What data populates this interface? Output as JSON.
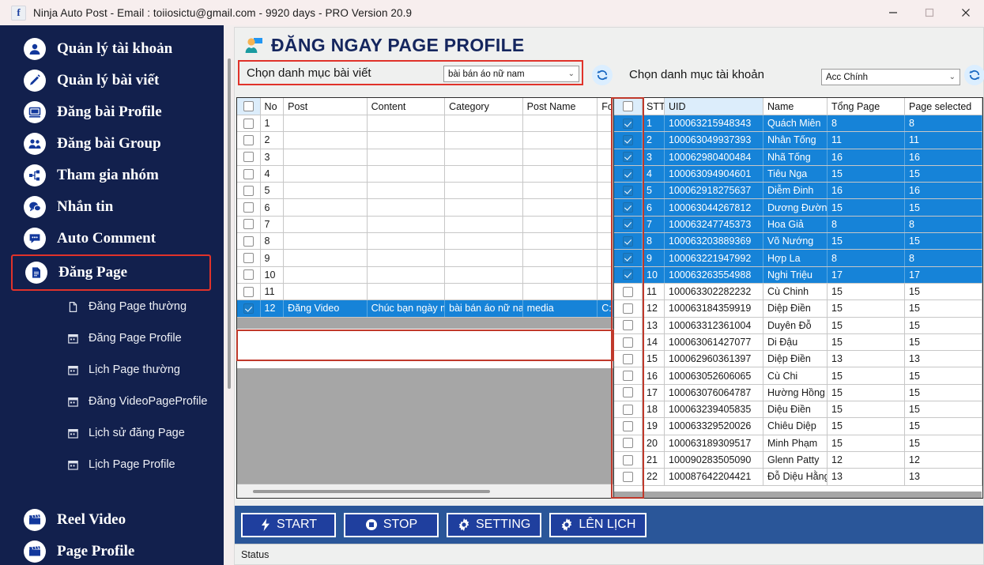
{
  "window": {
    "title": "Ninja Auto Post - Email : toiiosictu@gmail.com - 9920 days -  PRO Version 20.9",
    "app_icon": "facebook-icon",
    "minimize_label": "—",
    "maximize_label": "□",
    "close_label": "✕"
  },
  "sidebar": {
    "items": [
      {
        "label": "Quản lý tài khoản",
        "icon": "user-icon"
      },
      {
        "label": "Quản lý bài viết",
        "icon": "pencil-icon"
      },
      {
        "label": "Đăng bài Profile",
        "icon": "monitor-icon"
      },
      {
        "label": "Đăng bài Group",
        "icon": "users-icon"
      },
      {
        "label": "Tham gia nhóm",
        "icon": "network-icon"
      },
      {
        "label": "Nhắn tin",
        "icon": "chat-icon"
      },
      {
        "label": "Auto Comment",
        "icon": "comment-icon"
      },
      {
        "label": "Đăng Page",
        "icon": "document-icon"
      }
    ],
    "sub_items": [
      {
        "label": "Đăng Page thường",
        "icon": "page-icon"
      },
      {
        "label": "Đăng Page Profile",
        "icon": "calendar-icon"
      },
      {
        "label": "Lịch Page thường",
        "icon": "calendar-icon"
      },
      {
        "label": "Đăng VideoPageProfile",
        "icon": "calendar-icon"
      },
      {
        "label": "Lịch sử đăng Page",
        "icon": "calendar-icon"
      },
      {
        "label": "Lịch Page Profile",
        "icon": "calendar-icon"
      }
    ],
    "bottom_items": [
      {
        "label": "Reel Video",
        "icon": "clapperboard-icon"
      },
      {
        "label": "Page Profile",
        "icon": "clapperboard-icon"
      }
    ],
    "active_item": "Đăng Page",
    "highlight_color": "#e0322a",
    "background": "#12204d"
  },
  "header": {
    "title": "ĐĂNG NGAY PAGE PROFILE",
    "icon": "user-card-icon",
    "title_color": "#15265e"
  },
  "toolbar": {
    "post_category_label": "Chọn danh mục bài viết",
    "post_category_value": "bài bán áo nữ nam",
    "account_category_label": "Chọn danh mục tài khoản",
    "account_category_value": "Acc Chính",
    "refresh_icon": "refresh-icon"
  },
  "post_grid": {
    "columns": [
      "",
      "No",
      "Post",
      "Content",
      "Category",
      "Post Name",
      "Fo"
    ],
    "rows": [
      {
        "checked": false,
        "no": "1",
        "post": "",
        "content": "",
        "category": "",
        "post_name": "",
        "folder": ""
      },
      {
        "checked": false,
        "no": "2",
        "post": "",
        "content": "",
        "category": "",
        "post_name": "",
        "folder": ""
      },
      {
        "checked": false,
        "no": "3",
        "post": "",
        "content": "",
        "category": "",
        "post_name": "",
        "folder": ""
      },
      {
        "checked": false,
        "no": "4",
        "post": "",
        "content": "",
        "category": "",
        "post_name": "",
        "folder": ""
      },
      {
        "checked": false,
        "no": "5",
        "post": "",
        "content": "",
        "category": "",
        "post_name": "",
        "folder": ""
      },
      {
        "checked": false,
        "no": "6",
        "post": "",
        "content": "",
        "category": "",
        "post_name": "",
        "folder": ""
      },
      {
        "checked": false,
        "no": "7",
        "post": "",
        "content": "",
        "category": "",
        "post_name": "",
        "folder": ""
      },
      {
        "checked": false,
        "no": "8",
        "post": "",
        "content": "",
        "category": "",
        "post_name": "",
        "folder": ""
      },
      {
        "checked": false,
        "no": "9",
        "post": "",
        "content": "",
        "category": "",
        "post_name": "",
        "folder": ""
      },
      {
        "checked": false,
        "no": "10",
        "post": "",
        "content": "",
        "category": "",
        "post_name": "",
        "folder": ""
      },
      {
        "checked": false,
        "no": "11",
        "post": "",
        "content": "",
        "category": "",
        "post_name": "",
        "folder": ""
      },
      {
        "checked": true,
        "no": "12",
        "post": "Đăng Video",
        "content": "Chúc bạn ngày m...",
        "category": "bài bán áo nữ nam",
        "post_name": "media",
        "folder": "C:\\"
      }
    ]
  },
  "account_grid": {
    "columns": [
      "",
      "STT",
      "UID",
      "Name",
      "Tổng Page",
      "Page selected"
    ],
    "header_checked": false,
    "rows": [
      {
        "checked": true,
        "stt": "1",
        "uid": "100063215948343",
        "name": "Quách Miên",
        "total_page": "8",
        "page_selected": "8"
      },
      {
        "checked": true,
        "stt": "2",
        "uid": "100063049937393",
        "name": "Nhân Tống",
        "total_page": "11",
        "page_selected": "11"
      },
      {
        "checked": true,
        "stt": "3",
        "uid": "100062980400484",
        "name": "Nhã Tống",
        "total_page": "16",
        "page_selected": "16"
      },
      {
        "checked": true,
        "stt": "4",
        "uid": "100063094904601",
        "name": "Tiêu Nga",
        "total_page": "15",
        "page_selected": "15"
      },
      {
        "checked": true,
        "stt": "5",
        "uid": "100062918275637",
        "name": "Diễm Đinh",
        "total_page": "16",
        "page_selected": "16"
      },
      {
        "checked": true,
        "stt": "6",
        "uid": "100063044267812",
        "name": "Dương Đường",
        "total_page": "15",
        "page_selected": "15"
      },
      {
        "checked": true,
        "stt": "7",
        "uid": "100063247745373",
        "name": "Hoa Giả",
        "total_page": "8",
        "page_selected": "8"
      },
      {
        "checked": true,
        "stt": "8",
        "uid": "100063203889369",
        "name": "Võ Nướng",
        "total_page": "15",
        "page_selected": "15"
      },
      {
        "checked": true,
        "stt": "9",
        "uid": "100063221947992",
        "name": "Hợp La",
        "total_page": "8",
        "page_selected": "8"
      },
      {
        "checked": true,
        "stt": "10",
        "uid": "100063263554988",
        "name": "Nghi Triệu",
        "total_page": "17",
        "page_selected": "17"
      },
      {
        "checked": false,
        "stt": "11",
        "uid": "100063302282232",
        "name": "Cù Chinh",
        "total_page": "15",
        "page_selected": "15"
      },
      {
        "checked": false,
        "stt": "12",
        "uid": "100063184359919",
        "name": "Diệp Điền",
        "total_page": "15",
        "page_selected": "15"
      },
      {
        "checked": false,
        "stt": "13",
        "uid": "100063312361004",
        "name": "Duyên Đỗ",
        "total_page": "15",
        "page_selected": "15"
      },
      {
        "checked": false,
        "stt": "14",
        "uid": "100063061427077",
        "name": "Di Đậu",
        "total_page": "15",
        "page_selected": "15"
      },
      {
        "checked": false,
        "stt": "15",
        "uid": "100062960361397",
        "name": "Diệp Điền",
        "total_page": "13",
        "page_selected": "13"
      },
      {
        "checked": false,
        "stt": "16",
        "uid": "100063052606065",
        "name": "Cù Chi",
        "total_page": "15",
        "page_selected": "15"
      },
      {
        "checked": false,
        "stt": "17",
        "uid": "100063076064787",
        "name": "Hường Hồng",
        "total_page": "15",
        "page_selected": "15"
      },
      {
        "checked": false,
        "stt": "18",
        "uid": "100063239405835",
        "name": "Diệu Điền",
        "total_page": "15",
        "page_selected": "15"
      },
      {
        "checked": false,
        "stt": "19",
        "uid": "100063329520026",
        "name": "Chiêu Diệp",
        "total_page": "15",
        "page_selected": "15"
      },
      {
        "checked": false,
        "stt": "20",
        "uid": "100063189309517",
        "name": "Minh Phạm",
        "total_page": "15",
        "page_selected": "15"
      },
      {
        "checked": false,
        "stt": "21",
        "uid": "100090283505090",
        "name": "Glenn Patty",
        "total_page": "12",
        "page_selected": "12"
      },
      {
        "checked": false,
        "stt": "22",
        "uid": "100087642204421",
        "name": "Đỗ Diệu Hằng",
        "total_page": "13",
        "page_selected": "13"
      }
    ]
  },
  "buttons": {
    "start": "START",
    "stop": "STOP",
    "setting": "SETTING",
    "schedule": "LÊN LỊCH",
    "start_icon": "lightning-icon",
    "stop_icon": "stop-circle-icon",
    "setting_icon": "gear-icon",
    "schedule_icon": "gear-icon"
  },
  "statusbar": {
    "label": "Status"
  }
}
